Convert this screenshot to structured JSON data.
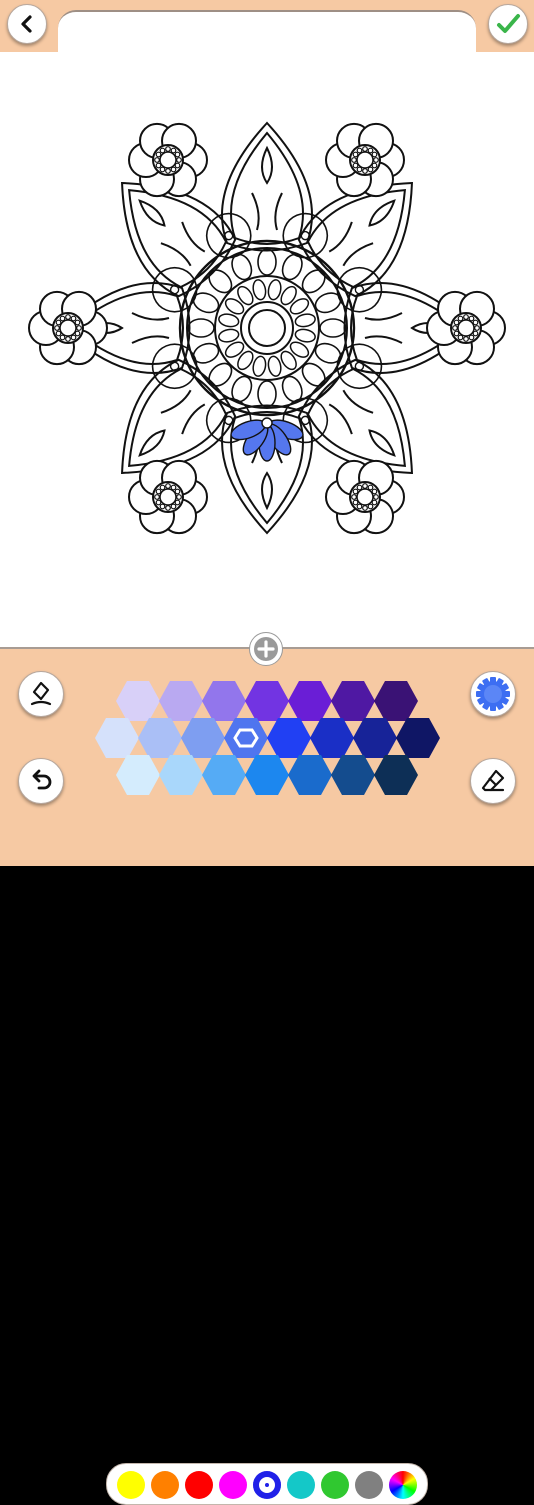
{
  "icons": {
    "back": "chevron-left-icon",
    "confirm": "checkmark-icon",
    "add": "plus-icon",
    "fill_tool": "brush-icon",
    "undo": "undo-icon",
    "settings": "gear-icon",
    "eraser": "eraser-icon"
  },
  "colors": {
    "bar": "#f6c9a3",
    "canvas": "#ffffff",
    "accent_selected": "#3355ee",
    "mandala_fill": "#5577ee",
    "confirm_green": "#3ab54a"
  },
  "swatches": [
    [
      "#d8d0f8",
      "#b9a9f1",
      "#9276ec",
      "#7234e2",
      "#6a1ed6",
      "#4f18a3",
      "#3a1275"
    ],
    [
      "#d5e1fb",
      "#aabff6",
      "#7e9ef1",
      "#4f75ef",
      "#2140f3",
      "#1a2fc6",
      "#172398",
      "#0f1665"
    ],
    [
      "#d4ecfd",
      "#a9d7fb",
      "#55abf5",
      "#1c87ef",
      "#1a6bcc",
      "#144c8e",
      "#0d2f56"
    ]
  ],
  "selected_swatch": "1.3",
  "color_strip": [
    "#ffff00",
    "#ff8000",
    "#ff0000",
    "#ff00ff",
    "#2020e8",
    "#14c8c8",
    "#30c830",
    "#808080",
    "rainbow"
  ],
  "selected_strip": 4
}
